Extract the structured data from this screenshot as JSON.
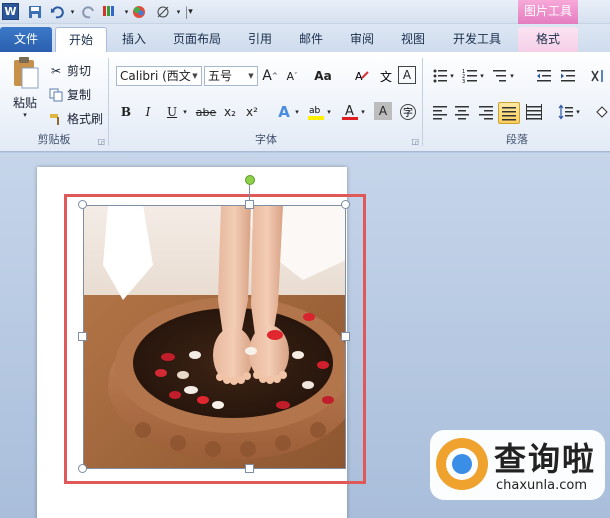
{
  "qat": {
    "app_icon": "word-logo",
    "items": [
      "save-icon",
      "undo-icon",
      "redo-icon",
      "format-painter-icon",
      "color-icon",
      "draw-icon"
    ],
    "customize": "▾"
  },
  "contextual_tab": {
    "label": "图片工具",
    "color": "#e57cbf"
  },
  "tabs": [
    {
      "label": "文件",
      "id": "file"
    },
    {
      "label": "开始",
      "id": "home",
      "active": true
    },
    {
      "label": "插入",
      "id": "insert"
    },
    {
      "label": "页面布局",
      "id": "page-layout"
    },
    {
      "label": "引用",
      "id": "references"
    },
    {
      "label": "邮件",
      "id": "mailings"
    },
    {
      "label": "审阅",
      "id": "review"
    },
    {
      "label": "视图",
      "id": "view"
    },
    {
      "label": "开发工具",
      "id": "developer"
    },
    {
      "label": "格式",
      "id": "format"
    }
  ],
  "clipboard": {
    "paste_label": "粘贴",
    "cut_label": "剪切",
    "copy_label": "复制",
    "format_painter_label": "格式刷",
    "group_label": "剪贴板"
  },
  "font": {
    "font_name": "Calibri (西文",
    "font_size": "五号",
    "group_label": "字体",
    "grow_label": "A",
    "shrink_label": "A",
    "case_label": "Aa",
    "bold": "B",
    "italic": "I",
    "underline": "U",
    "strike": "abe",
    "subscript": "x₂",
    "superscript": "x²",
    "font_color": "A",
    "char_shade": "A"
  },
  "paragraph": {
    "group_label": "段落"
  },
  "watermark": {
    "title": "查询啦",
    "url": "chaxunla.com"
  },
  "colors": {
    "file_tab": "#2a5fae",
    "selection_outline": "#e05959",
    "rotate_handle": "#8ed04a"
  }
}
